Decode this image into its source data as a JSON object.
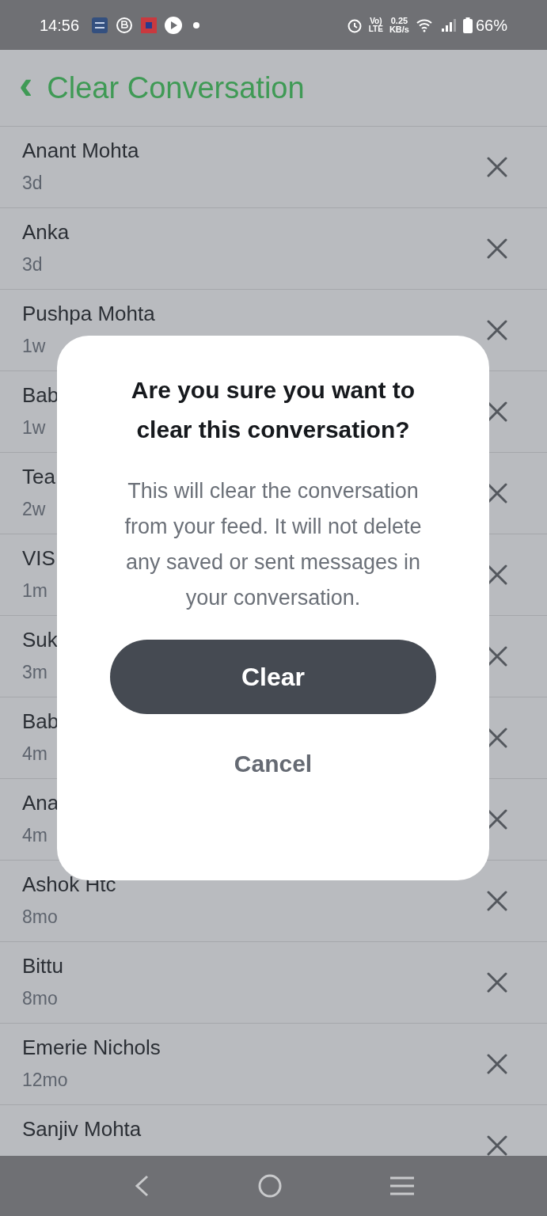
{
  "status_bar": {
    "time": "14:56",
    "network_type_top": "Vo)",
    "network_type_bottom": "LTE",
    "speed_value": "0.25",
    "speed_unit": "KB/s",
    "battery": "66%"
  },
  "header": {
    "back": "‹",
    "title": "Clear Conversation"
  },
  "conversations": [
    {
      "name": "Anant Mohta",
      "time": "3d"
    },
    {
      "name": "Anka",
      "time": "3d"
    },
    {
      "name": "Pushpa Mohta",
      "time": "1w"
    },
    {
      "name": "Bab",
      "time": "1w"
    },
    {
      "name": "Tea",
      "time": "2w"
    },
    {
      "name": "VIS",
      "time": "1m"
    },
    {
      "name": "Suk",
      "time": "3m"
    },
    {
      "name": "Bab",
      "time": "4m"
    },
    {
      "name": "Ana",
      "time": "4m"
    },
    {
      "name": "Ashok Htc",
      "time": "8mo"
    },
    {
      "name": "Bittu",
      "time": "8mo"
    },
    {
      "name": "Emerie Nichols",
      "time": "12mo"
    },
    {
      "name": "Sanjiv Mohta"
    }
  ],
  "dialog": {
    "title": "Are you sure you want to clear this conversation?",
    "message": "This will clear the conversation from your feed. It will not delete any saved or sent messages in your conversation.",
    "confirm": "Clear",
    "cancel": "Cancel"
  }
}
